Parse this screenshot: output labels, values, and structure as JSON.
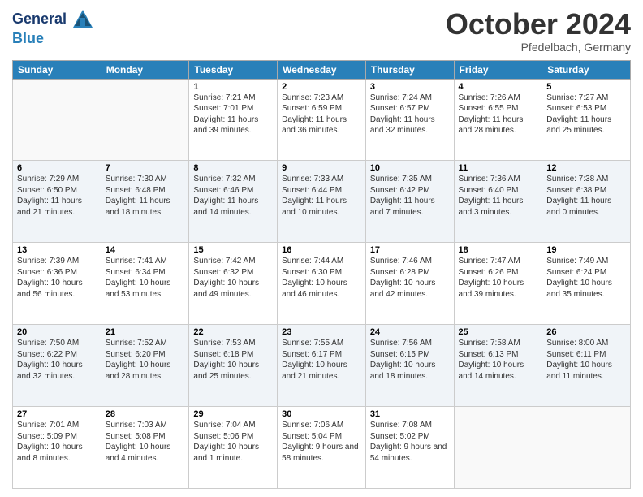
{
  "logo": {
    "line1": "General",
    "line2": "Blue"
  },
  "title": "October 2024",
  "location": "Pfedelbach, Germany",
  "weekdays": [
    "Sunday",
    "Monday",
    "Tuesday",
    "Wednesday",
    "Thursday",
    "Friday",
    "Saturday"
  ],
  "weeks": [
    [
      {
        "day": "",
        "sunrise": "",
        "sunset": "",
        "daylight": ""
      },
      {
        "day": "",
        "sunrise": "",
        "sunset": "",
        "daylight": ""
      },
      {
        "day": "1",
        "sunrise": "Sunrise: 7:21 AM",
        "sunset": "Sunset: 7:01 PM",
        "daylight": "Daylight: 11 hours and 39 minutes."
      },
      {
        "day": "2",
        "sunrise": "Sunrise: 7:23 AM",
        "sunset": "Sunset: 6:59 PM",
        "daylight": "Daylight: 11 hours and 36 minutes."
      },
      {
        "day": "3",
        "sunrise": "Sunrise: 7:24 AM",
        "sunset": "Sunset: 6:57 PM",
        "daylight": "Daylight: 11 hours and 32 minutes."
      },
      {
        "day": "4",
        "sunrise": "Sunrise: 7:26 AM",
        "sunset": "Sunset: 6:55 PM",
        "daylight": "Daylight: 11 hours and 28 minutes."
      },
      {
        "day": "5",
        "sunrise": "Sunrise: 7:27 AM",
        "sunset": "Sunset: 6:53 PM",
        "daylight": "Daylight: 11 hours and 25 minutes."
      }
    ],
    [
      {
        "day": "6",
        "sunrise": "Sunrise: 7:29 AM",
        "sunset": "Sunset: 6:50 PM",
        "daylight": "Daylight: 11 hours and 21 minutes."
      },
      {
        "day": "7",
        "sunrise": "Sunrise: 7:30 AM",
        "sunset": "Sunset: 6:48 PM",
        "daylight": "Daylight: 11 hours and 18 minutes."
      },
      {
        "day": "8",
        "sunrise": "Sunrise: 7:32 AM",
        "sunset": "Sunset: 6:46 PM",
        "daylight": "Daylight: 11 hours and 14 minutes."
      },
      {
        "day": "9",
        "sunrise": "Sunrise: 7:33 AM",
        "sunset": "Sunset: 6:44 PM",
        "daylight": "Daylight: 11 hours and 10 minutes."
      },
      {
        "day": "10",
        "sunrise": "Sunrise: 7:35 AM",
        "sunset": "Sunset: 6:42 PM",
        "daylight": "Daylight: 11 hours and 7 minutes."
      },
      {
        "day": "11",
        "sunrise": "Sunrise: 7:36 AM",
        "sunset": "Sunset: 6:40 PM",
        "daylight": "Daylight: 11 hours and 3 minutes."
      },
      {
        "day": "12",
        "sunrise": "Sunrise: 7:38 AM",
        "sunset": "Sunset: 6:38 PM",
        "daylight": "Daylight: 11 hours and 0 minutes."
      }
    ],
    [
      {
        "day": "13",
        "sunrise": "Sunrise: 7:39 AM",
        "sunset": "Sunset: 6:36 PM",
        "daylight": "Daylight: 10 hours and 56 minutes."
      },
      {
        "day": "14",
        "sunrise": "Sunrise: 7:41 AM",
        "sunset": "Sunset: 6:34 PM",
        "daylight": "Daylight: 10 hours and 53 minutes."
      },
      {
        "day": "15",
        "sunrise": "Sunrise: 7:42 AM",
        "sunset": "Sunset: 6:32 PM",
        "daylight": "Daylight: 10 hours and 49 minutes."
      },
      {
        "day": "16",
        "sunrise": "Sunrise: 7:44 AM",
        "sunset": "Sunset: 6:30 PM",
        "daylight": "Daylight: 10 hours and 46 minutes."
      },
      {
        "day": "17",
        "sunrise": "Sunrise: 7:46 AM",
        "sunset": "Sunset: 6:28 PM",
        "daylight": "Daylight: 10 hours and 42 minutes."
      },
      {
        "day": "18",
        "sunrise": "Sunrise: 7:47 AM",
        "sunset": "Sunset: 6:26 PM",
        "daylight": "Daylight: 10 hours and 39 minutes."
      },
      {
        "day": "19",
        "sunrise": "Sunrise: 7:49 AM",
        "sunset": "Sunset: 6:24 PM",
        "daylight": "Daylight: 10 hours and 35 minutes."
      }
    ],
    [
      {
        "day": "20",
        "sunrise": "Sunrise: 7:50 AM",
        "sunset": "Sunset: 6:22 PM",
        "daylight": "Daylight: 10 hours and 32 minutes."
      },
      {
        "day": "21",
        "sunrise": "Sunrise: 7:52 AM",
        "sunset": "Sunset: 6:20 PM",
        "daylight": "Daylight: 10 hours and 28 minutes."
      },
      {
        "day": "22",
        "sunrise": "Sunrise: 7:53 AM",
        "sunset": "Sunset: 6:18 PM",
        "daylight": "Daylight: 10 hours and 25 minutes."
      },
      {
        "day": "23",
        "sunrise": "Sunrise: 7:55 AM",
        "sunset": "Sunset: 6:17 PM",
        "daylight": "Daylight: 10 hours and 21 minutes."
      },
      {
        "day": "24",
        "sunrise": "Sunrise: 7:56 AM",
        "sunset": "Sunset: 6:15 PM",
        "daylight": "Daylight: 10 hours and 18 minutes."
      },
      {
        "day": "25",
        "sunrise": "Sunrise: 7:58 AM",
        "sunset": "Sunset: 6:13 PM",
        "daylight": "Daylight: 10 hours and 14 minutes."
      },
      {
        "day": "26",
        "sunrise": "Sunrise: 8:00 AM",
        "sunset": "Sunset: 6:11 PM",
        "daylight": "Daylight: 10 hours and 11 minutes."
      }
    ],
    [
      {
        "day": "27",
        "sunrise": "Sunrise: 7:01 AM",
        "sunset": "Sunset: 5:09 PM",
        "daylight": "Daylight: 10 hours and 8 minutes."
      },
      {
        "day": "28",
        "sunrise": "Sunrise: 7:03 AM",
        "sunset": "Sunset: 5:08 PM",
        "daylight": "Daylight: 10 hours and 4 minutes."
      },
      {
        "day": "29",
        "sunrise": "Sunrise: 7:04 AM",
        "sunset": "Sunset: 5:06 PM",
        "daylight": "Daylight: 10 hours and 1 minute."
      },
      {
        "day": "30",
        "sunrise": "Sunrise: 7:06 AM",
        "sunset": "Sunset: 5:04 PM",
        "daylight": "Daylight: 9 hours and 58 minutes."
      },
      {
        "day": "31",
        "sunrise": "Sunrise: 7:08 AM",
        "sunset": "Sunset: 5:02 PM",
        "daylight": "Daylight: 9 hours and 54 minutes."
      },
      {
        "day": "",
        "sunrise": "",
        "sunset": "",
        "daylight": ""
      },
      {
        "day": "",
        "sunrise": "",
        "sunset": "",
        "daylight": ""
      }
    ]
  ]
}
